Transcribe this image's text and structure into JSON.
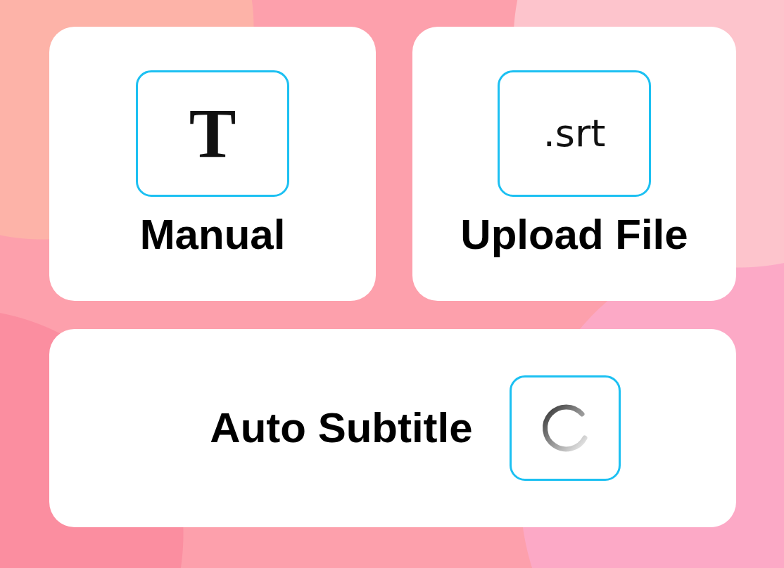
{
  "options": [
    {
      "kind": "serif",
      "glyph": "T",
      "label": "Manual"
    },
    {
      "kind": "plain",
      "glyph": ".srt",
      "label": "Upload File"
    }
  ],
  "auto": {
    "label": "Auto Subtitle",
    "kind": "spinner"
  }
}
